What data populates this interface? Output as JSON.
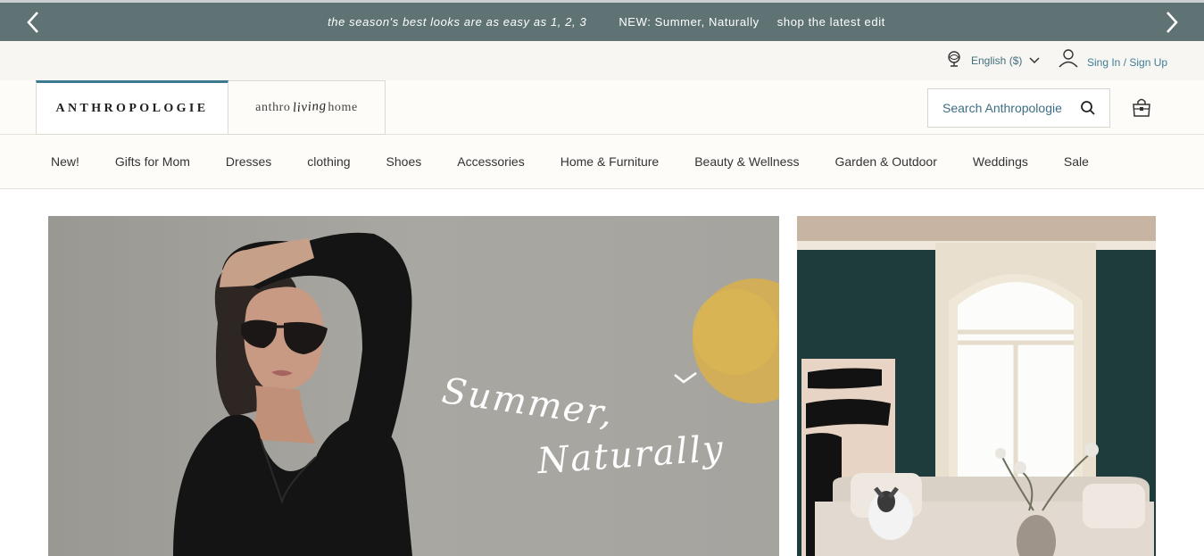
{
  "promo": {
    "message_1": "the season's best looks are as easy as 1, 2, 3",
    "message_2": "NEW: Summer, Naturally",
    "message_3": "shop the latest edit"
  },
  "utility": {
    "language": "English ($)",
    "signin": "Sing In / Sign Up"
  },
  "brands": {
    "anthro": "ANTHROPOLOGIE",
    "living_prefix": "anthro",
    "living_script": "living",
    "living_suffix": "home"
  },
  "search": {
    "placeholder": "Search Anthropologie"
  },
  "nav": {
    "items": [
      "New!",
      "Gifts for Mom",
      "Dresses",
      "clothing",
      "Shoes",
      "Accessories",
      "Home & Furniture",
      "Beauty & Wellness",
      "Garden & Outdoor",
      "Weddings",
      "Sale"
    ]
  },
  "hero": {
    "script_line_1": "Summer,",
    "script_line_2": "Naturally"
  },
  "colors": {
    "promo_bg": "#5f7375",
    "accent_link": "#3f7f97",
    "hero_sun": "#d8b04a",
    "room_wall": "#1e3b3b"
  }
}
